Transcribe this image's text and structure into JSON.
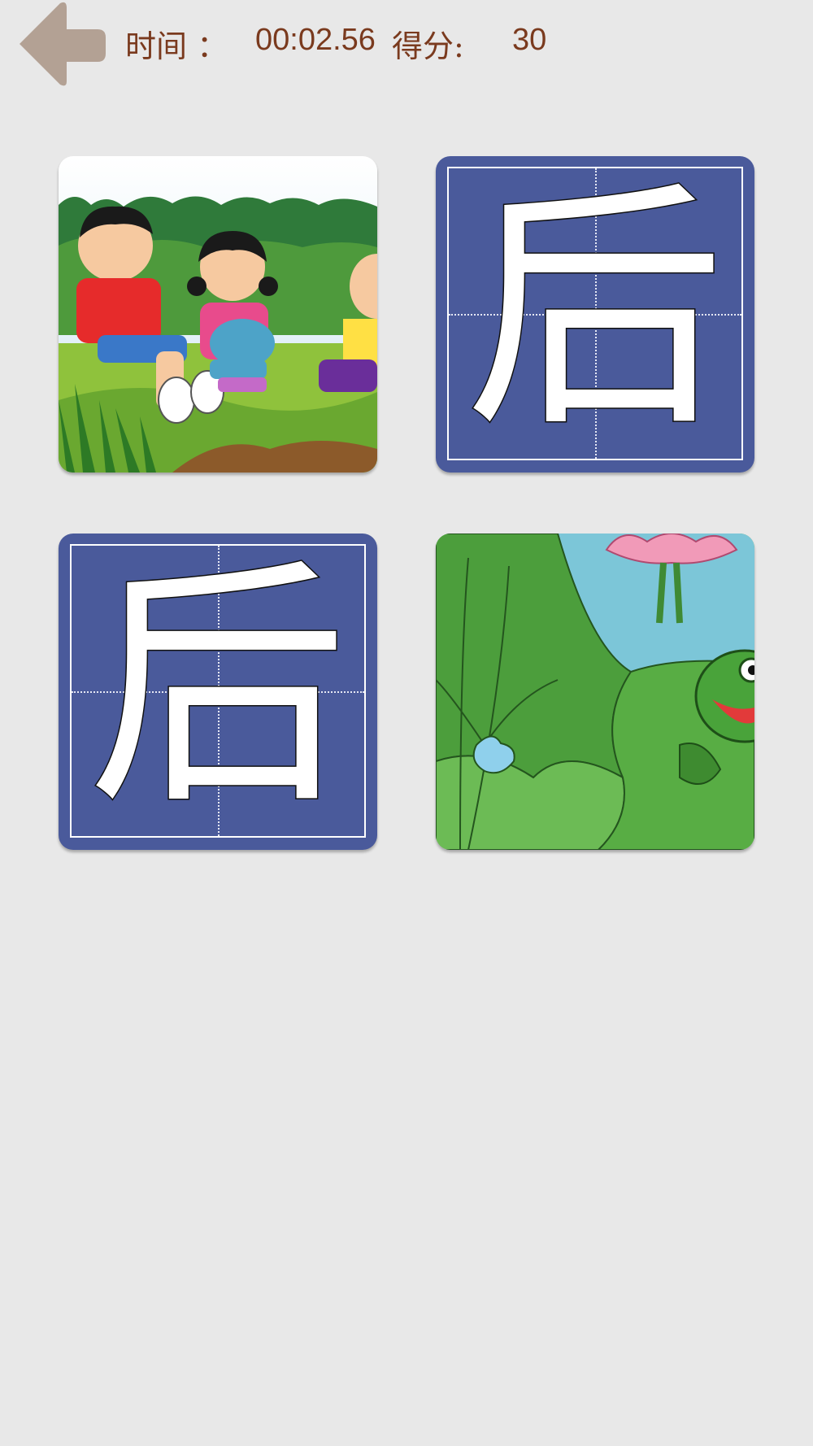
{
  "header": {
    "back_icon": "back-arrow-icon",
    "time_label": "时间 ：",
    "time_value": "00:02.56",
    "score_label": "得分:",
    "score_value": "30"
  },
  "cards": [
    {
      "kind": "picture",
      "icon": "children-on-grass-picture"
    },
    {
      "kind": "character",
      "char": "后"
    },
    {
      "kind": "character",
      "char": "后"
    },
    {
      "kind": "picture",
      "icon": "frog-lotus-picture"
    }
  ],
  "colors": {
    "text": "#7a3a1e",
    "card_blue": "#4a5a9b",
    "back_arrow": "#b3a194",
    "background": "#e8e8e8"
  }
}
